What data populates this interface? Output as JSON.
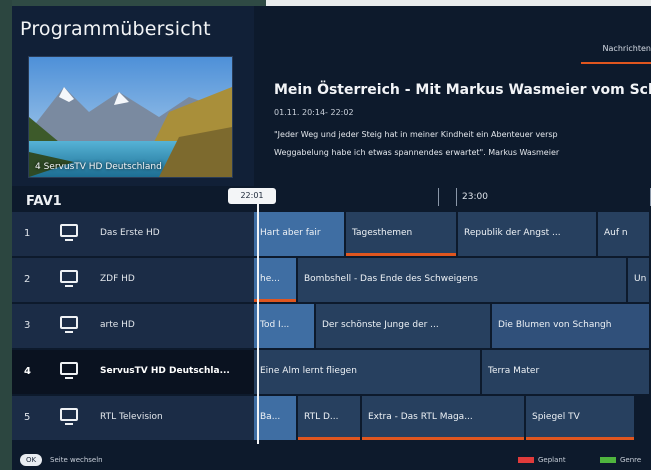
{
  "header": {
    "title": "Programmübersicht",
    "tab_label": "Nachrichten"
  },
  "preview": {
    "channel_label": "4 ServusTV HD Deutschland"
  },
  "program": {
    "title": "Mein Österreich - Mit Markus Wasmeier vom Schliers",
    "time": "01.11. 20:14- 22:02",
    "desc_line1": "\"Jeder Weg und jeder Steig hat in meiner Kindheit ein Abenteuer versp",
    "desc_line2": "Weggabelung habe ich etwas spannendes erwartet\". Markus Wasmeier"
  },
  "favorites": {
    "label": "FAV1"
  },
  "timebar": {
    "now": "22:01",
    "slot2": "23:00"
  },
  "channels": [
    {
      "num": "1",
      "name": "Das Erste HD"
    },
    {
      "num": "2",
      "name": "ZDF HD"
    },
    {
      "num": "3",
      "name": "arte HD"
    },
    {
      "num": "4",
      "name": "ServusTV HD Deutschla..."
    },
    {
      "num": "5",
      "name": "RTL Television"
    }
  ],
  "rows": [
    [
      "Hart aber fair",
      "Tagesthemen",
      "Republik der Angst ...",
      "Auf n"
    ],
    [
      "he...",
      "Bombshell - Das Ende des Schweigens",
      "Un"
    ],
    [
      "Tod I...",
      "Der schönste Junge der ...",
      "Die Blumen von Schangh"
    ],
    [
      "Eine Alm lernt fliegen",
      "Terra Mater"
    ],
    [
      "Ba...",
      "RTL D...",
      "Extra - Das RTL Maga...",
      "Spiegel TV"
    ]
  ],
  "footer": {
    "ok": "OK",
    "hint": "Seite wechseln",
    "legend_planned": "Geplant",
    "legend_genre": "Genre"
  },
  "colors": {
    "accent_orange": "#e0561f",
    "legend_red": "#e03b3b",
    "legend_green": "#4fb43e"
  }
}
